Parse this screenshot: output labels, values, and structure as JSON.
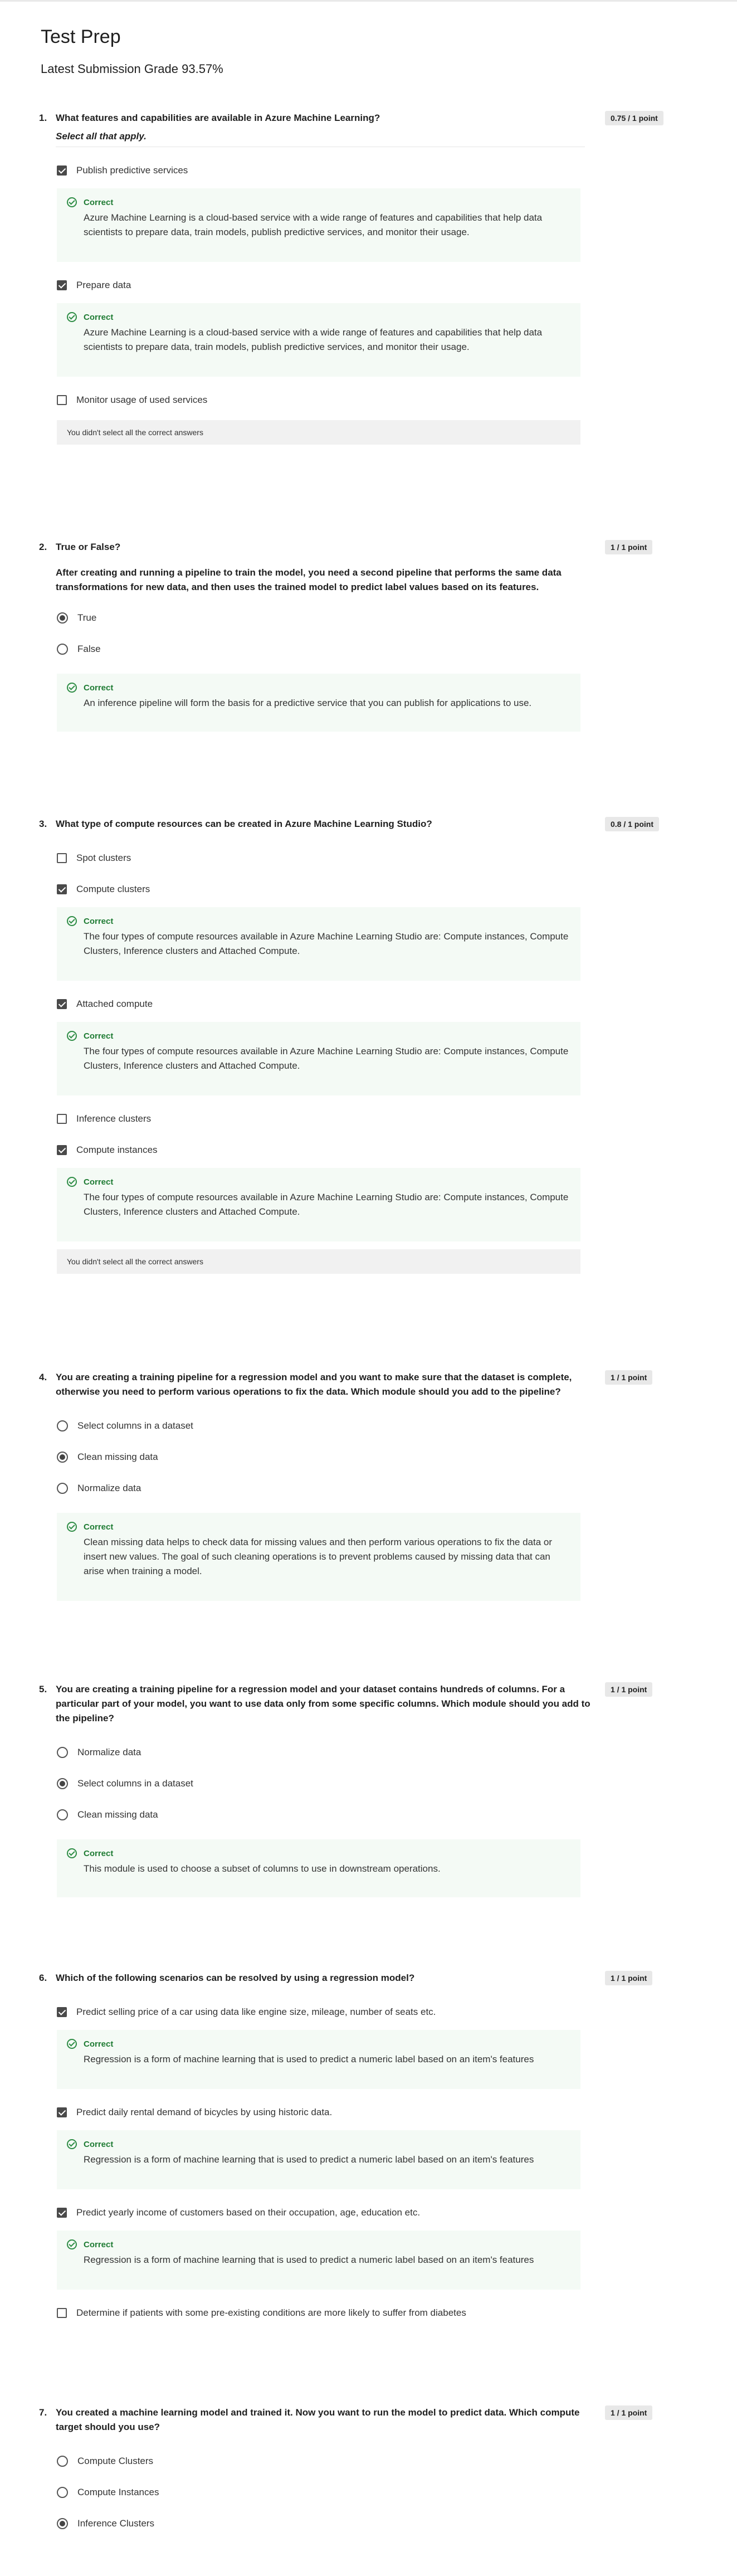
{
  "page": {
    "title": "Test Prep",
    "grade_label": "Latest Submission Grade 93.57%"
  },
  "labels": {
    "correct": "Correct",
    "missed": "You didn't select all the correct answers"
  },
  "colors": {
    "correct_green": "#1e7b33",
    "feedback_bg": "#f4faf5",
    "badge_bg": "#e8e8e8"
  },
  "icons": {
    "checkbox": "checkbox-icon",
    "radio": "radio-icon",
    "correct": "check-circle-icon"
  },
  "questions": [
    {
      "number": "1.",
      "text": "What features and capabilities are available in Azure Machine Learning?",
      "instruction": "Select all that apply.",
      "points": "0.75 / 1 point",
      "options": [
        {
          "label": "Publish predictive services",
          "selected": true,
          "feedback": "Azure Machine Learning is a cloud-based service with a wide range of features and capabilities that help data scientists to prepare data, train models, publish predictive services, and monitor their usage."
        },
        {
          "label": "Prepare data",
          "selected": true,
          "feedback": "Azure Machine Learning is a cloud-based service with a wide range of features and capabilities that help data scientists to prepare data, train models, publish predictive services, and monitor their usage."
        },
        {
          "label": "Monitor usage of used services",
          "selected": false
        }
      ]
    },
    {
      "number": "2.",
      "text": "True or False?",
      "statement": "After creating and running a pipeline to train the model, you need a second pipeline that performs the same data transformations for new data, and then uses the trained model to predict label values based on its features.",
      "points": "1 / 1 point",
      "options": [
        {
          "label": "True",
          "selected": true
        },
        {
          "label": "False",
          "selected": false
        }
      ],
      "feedback": "An inference pipeline will form the basis for a predictive service that you can publish for applications to use."
    },
    {
      "number": "3.",
      "text": "What type of compute resources can be created in Azure Machine Learning Studio?",
      "points": "0.8 / 1 point",
      "options": [
        {
          "label": "Spot clusters",
          "selected": false
        },
        {
          "label": "Compute clusters",
          "selected": true,
          "feedback": "The four types of compute resources available in Azure Machine Learning Studio are: Compute instances, Compute Clusters, Inference clusters and Attached Compute."
        },
        {
          "label": "Attached compute",
          "selected": true,
          "feedback": "The four types of compute resources available in Azure Machine Learning Studio are: Compute instances, Compute Clusters, Inference clusters and Attached Compute."
        },
        {
          "label": "Inference clusters",
          "selected": false
        },
        {
          "label": "Compute instances",
          "selected": true,
          "feedback": "The four types of compute resources available in Azure Machine Learning Studio are: Compute instances, Compute Clusters, Inference clusters and Attached Compute."
        }
      ]
    },
    {
      "number": "4.",
      "text": "You are creating a training pipeline for a regression model and you want to make sure that the dataset is complete, otherwise you need to perform various operations to fix the data. Which module should you add to the pipeline?",
      "points": "1 / 1 point",
      "options": [
        {
          "label": "Select columns in a dataset",
          "selected": false
        },
        {
          "label": "Clean missing data",
          "selected": true
        },
        {
          "label": "Normalize data",
          "selected": false
        }
      ],
      "feedback": "Clean missing data helps to check data for missing values and then perform various operations to fix the data or insert new values. The goal of such cleaning operations is to prevent problems caused by missing data that can arise when training a model."
    },
    {
      "number": "5.",
      "text": "You are creating a training pipeline for a regression model and your dataset contains hundreds of columns. For a particular part of your model, you want to use data only from some specific columns. Which module should you add to the pipeline?",
      "points": "1 / 1 point",
      "options": [
        {
          "label": "Normalize data",
          "selected": false
        },
        {
          "label": "Select columns in a dataset",
          "selected": true
        },
        {
          "label": "Clean missing data",
          "selected": false
        }
      ],
      "feedback": "This module is used to choose a subset of columns to use in downstream operations."
    },
    {
      "number": "6.",
      "text": "Which of the following scenarios can be resolved by using a regression model?",
      "points": "1 / 1 point",
      "options": [
        {
          "label": "Predict selling price of a car using data like engine size, mileage, number of seats etc.",
          "selected": true,
          "feedback": "Regression is a form of machine learning that is used to predict a numeric label based on an item's features"
        },
        {
          "label": "Predict daily rental demand of bicycles by using historic data.",
          "selected": true,
          "feedback": "Regression is a form of machine learning that is used to predict a numeric label based on an item's features"
        },
        {
          "label": "Predict yearly income of customers based on their occupation, age, education etc.",
          "selected": true,
          "feedback": "Regression is a form of machine learning that is used to predict a numeric label based on an item's features"
        },
        {
          "label": "Determine if patients with some pre-existing conditions are more likely to suffer from diabetes",
          "selected": false
        }
      ]
    },
    {
      "number": "7.",
      "text": "You created a machine learning model and trained it. Now you want to run the model to predict data. Which compute target should you use?",
      "points": "1 / 1 point",
      "options": [
        {
          "label": "Compute Clusters",
          "selected": false
        },
        {
          "label": "Compute Instances",
          "selected": false
        },
        {
          "label": "Inference Clusters",
          "selected": true
        }
      ]
    }
  ]
}
